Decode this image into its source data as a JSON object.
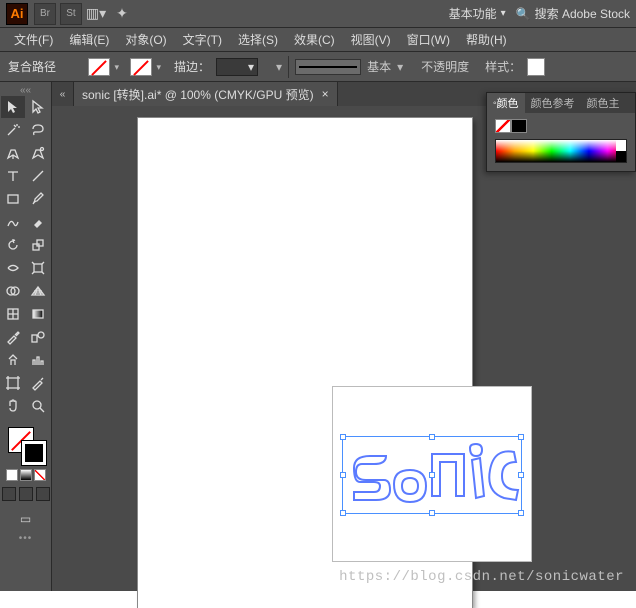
{
  "brand": {
    "ai": "Ai",
    "br": "Br",
    "st": "St"
  },
  "workspace": {
    "label": "基本功能"
  },
  "search": {
    "placeholder": "搜索 Adobe Stock"
  },
  "menu": {
    "file": "文件(F)",
    "edit": "编辑(E)",
    "object": "对象(O)",
    "type": "文字(T)",
    "select": "选择(S)",
    "effect": "效果(C)",
    "view": "视图(V)",
    "window": "窗口(W)",
    "help": "帮助(H)"
  },
  "ctrl": {
    "pathType": "复合路径",
    "strokeLabel": "描边：",
    "strokeValue": "",
    "brushLabel": "基本",
    "opacityLabel": "不透明度",
    "styleLabel": "样式："
  },
  "doc": {
    "title": "sonic [转换].ai* @ 100% (CMYK/GPU 预览)"
  },
  "colorPanel": {
    "tabs": {
      "c1": "颜色",
      "c2": "颜色参考",
      "c3": "颜色主"
    }
  },
  "watermark": "https://blog.csdn.net/sonicwater"
}
